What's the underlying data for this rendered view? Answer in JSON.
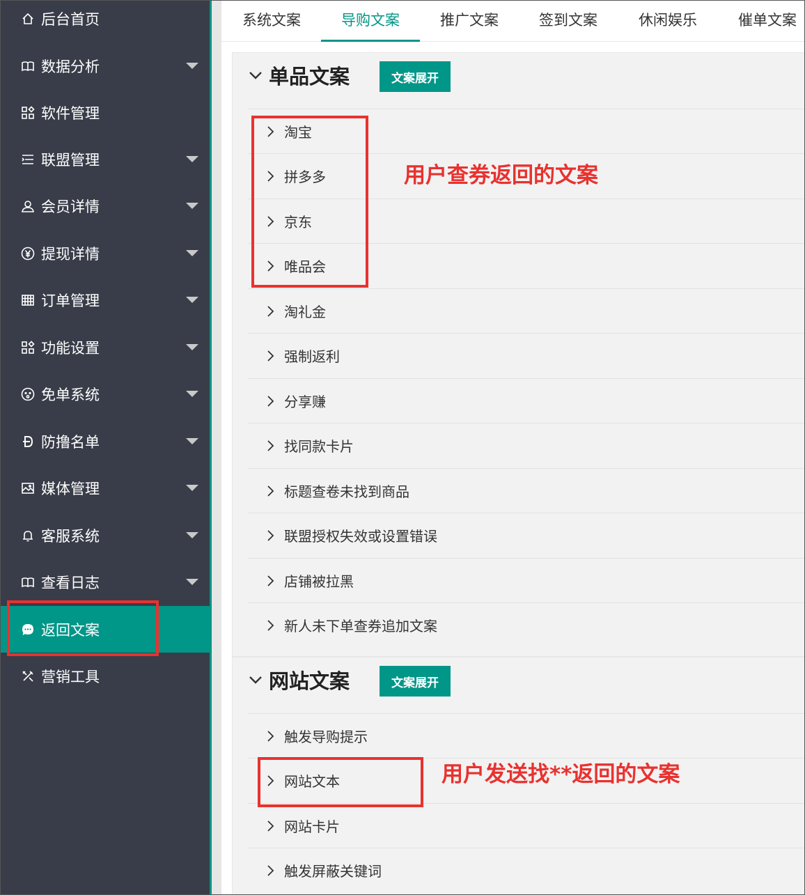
{
  "sidebar": {
    "items": [
      {
        "label": "后台首页",
        "icon": "home-icon",
        "has_arrow": false
      },
      {
        "label": "数据分析",
        "icon": "book-icon",
        "has_arrow": true
      },
      {
        "label": "软件管理",
        "icon": "apps-icon",
        "has_arrow": false
      },
      {
        "label": "联盟管理",
        "icon": "list-icon",
        "has_arrow": true
      },
      {
        "label": "会员详情",
        "icon": "user-icon",
        "has_arrow": true
      },
      {
        "label": "提现详情",
        "icon": "yen-icon",
        "has_arrow": true
      },
      {
        "label": "订单管理",
        "icon": "grid-icon",
        "has_arrow": true
      },
      {
        "label": "功能设置",
        "icon": "apps-icon",
        "has_arrow": true
      },
      {
        "label": "免单系统",
        "icon": "face-icon",
        "has_arrow": true
      },
      {
        "label": "防撸名单",
        "icon": "dong-icon",
        "has_arrow": true
      },
      {
        "label": "媒体管理",
        "icon": "image-icon",
        "has_arrow": true
      },
      {
        "label": "客服系统",
        "icon": "bell-icon",
        "has_arrow": true
      },
      {
        "label": "查看日志",
        "icon": "book-icon",
        "has_arrow": true
      },
      {
        "label": "返回文案",
        "icon": "chat-icon",
        "has_arrow": false,
        "active": true
      },
      {
        "label": "营销工具",
        "icon": "tools-icon",
        "has_arrow": false
      }
    ]
  },
  "tabs": [
    {
      "label": "系统文案"
    },
    {
      "label": "导购文案",
      "active": true
    },
    {
      "label": "推广文案"
    },
    {
      "label": "签到文案"
    },
    {
      "label": "休闲娱乐"
    },
    {
      "label": "催单文案"
    }
  ],
  "panels": [
    {
      "title": "单品文案",
      "button": "文案展开",
      "rows": [
        "淘宝",
        "拼多多",
        "京东",
        "唯品会",
        "淘礼金",
        "强制返利",
        "分享赚",
        "找同款卡片",
        "标题查卷未找到商品",
        "联盟授权失效或设置错误",
        "店铺被拉黑",
        "新人未下单查券追加文案"
      ]
    },
    {
      "title": "网站文案",
      "button": "文案展开",
      "rows": [
        "触发导购提示",
        "网站文本",
        "网站卡片",
        "触发屏蔽关键词"
      ]
    }
  ],
  "annotations": {
    "note1": "用户查券返回的文案",
    "note2": "用户发送找**返回的文案",
    "color": "#e8322f"
  },
  "colors": {
    "sidebar_bg": "#393d49",
    "accent": "#009688"
  }
}
